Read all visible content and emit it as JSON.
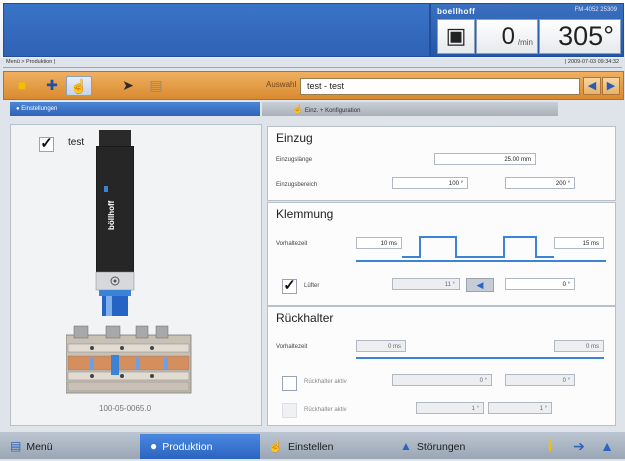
{
  "header": {
    "brand": "boellhoff",
    "machine_id": "FM-4052  25309",
    "machine_icon": "machine-icon",
    "speed_value": "0",
    "speed_unit": "/min",
    "angle_value": "305°"
  },
  "breadcrumb": "Menü > Produktion |",
  "datetime": "| 2009-07-03 09:34:32",
  "toolbar": {
    "buttons": [
      "folder-icon",
      "wrench-icon",
      "hand-icon",
      "drop-icon",
      "document-icon"
    ],
    "selected_index": 2,
    "selection_label": "Auswahl",
    "selection_value": "test - test",
    "prev_icon": "arrow-left-icon",
    "next_icon": "arrow-right-icon"
  },
  "tabs": {
    "settings": "Einstellungen",
    "feed": "Einz. + Konfiguration"
  },
  "left_panel": {
    "tool_name": "test",
    "tool_checked": true,
    "tool_brand": "böllhoff",
    "tool_code": "100-05-0065.0"
  },
  "einzug": {
    "title": "Einzug",
    "length_label": "Einzugslänge",
    "length_value": "25.00 mm",
    "range_label": "Einzugsbereich",
    "range_from": "100 °",
    "range_to": "200 °"
  },
  "klemmung": {
    "title": "Klemmung",
    "lead_label": "Vorhaltezeit",
    "lead_start": "10 ms",
    "lead_end": "15 ms",
    "lift_label": "Lüfter",
    "lift_checked": true,
    "lift_from": "11 °",
    "lift_to": "0 °"
  },
  "rueckhalter": {
    "title": "Rückhalter",
    "lead_label": "Vorhaltezeit",
    "lead_start": "0 ms",
    "lead_end": "0 ms",
    "active_label_1": "Rückhalter aktiv",
    "active_from_1": "0 °",
    "active_to_1": "0 °",
    "active_label_2": "Rückhalter aktiv",
    "active_from_2": "1 °",
    "active_to_2": "1 °"
  },
  "statusbar": {
    "menu": "Menü",
    "production": "Produktion",
    "settings": "Einstellen",
    "faults": "Störungen"
  },
  "colors": {
    "header_blue": "#2f62b4",
    "toolbar_orange": "#e09a44",
    "accent_blue": "#3b83d6"
  }
}
